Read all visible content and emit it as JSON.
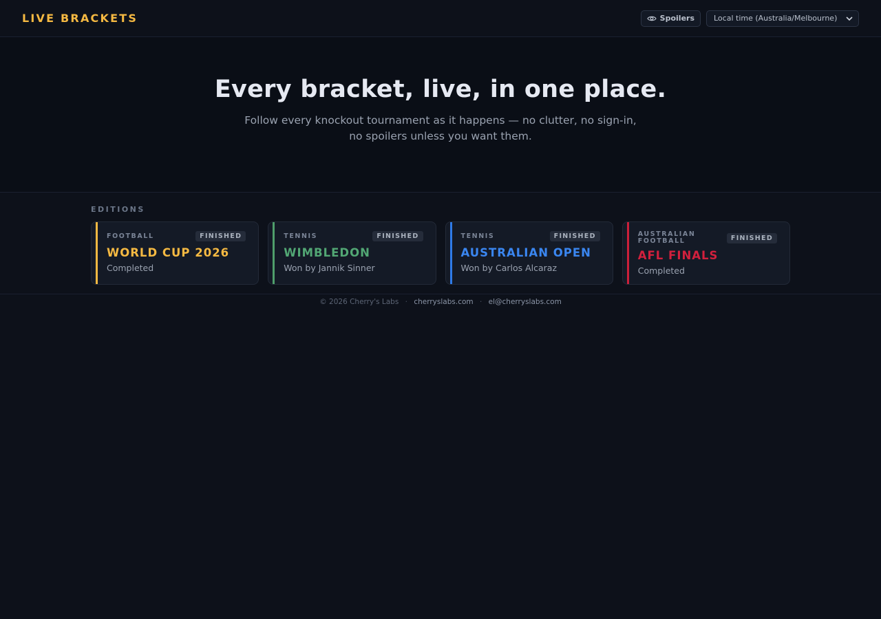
{
  "header": {
    "brand": "LIVE BRACKETS",
    "spoilers_label": "Spoilers",
    "timezone_selected": "Local time (Australia/Melbourne)"
  },
  "hero": {
    "title": "Every bracket, live, in one place.",
    "subtitle_line1": "Follow every knockout tournament as it happens — no clutter, no sign-in,",
    "subtitle_line2": "no spoilers unless you want them."
  },
  "editions": {
    "label": "EDITIONS",
    "cards": [
      {
        "sport": "FOOTBALL",
        "status": "FINISHED",
        "title": "WORLD CUP 2026",
        "subtitle": "Completed",
        "accent": "#f5b942"
      },
      {
        "sport": "TENNIS",
        "status": "FINISHED",
        "title": "WIMBLEDON",
        "subtitle": "Won by Jannik Sinner",
        "accent": "#4f9e6b"
      },
      {
        "sport": "TENNIS",
        "status": "FINISHED",
        "title": "AUSTRALIAN OPEN",
        "subtitle": "Won by Carlos Alcaraz",
        "accent": "#2f7be8"
      },
      {
        "sport": "AUSTRALIAN FOOTBALL",
        "status": "FINISHED",
        "title": "AFL FINALS",
        "subtitle": "Completed",
        "accent": "#cc1f3a"
      }
    ]
  },
  "footer": {
    "copyright": "© 2026 Cherry's Labs",
    "site_link": "cherryslabs.com",
    "email_link": "el@cherryslabs.com",
    "separator": "·"
  }
}
